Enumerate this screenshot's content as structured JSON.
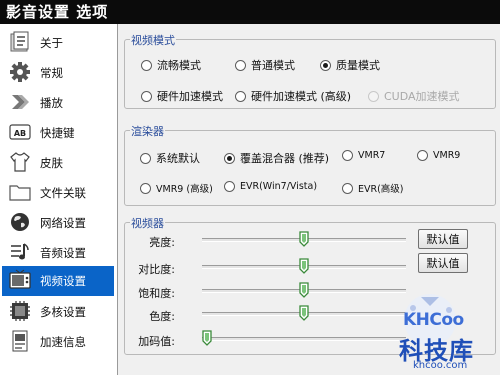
{
  "window": {
    "title": "影音设置 选项"
  },
  "sidebar": {
    "items": [
      {
        "label": "关于",
        "icon": "info-icon"
      },
      {
        "label": "常规",
        "icon": "gear-icon"
      },
      {
        "label": "播放",
        "icon": "play-icon"
      },
      {
        "label": "快捷键",
        "icon": "keyboard-ab-icon"
      },
      {
        "label": "皮肤",
        "icon": "shirt-icon"
      },
      {
        "label": "文件关联",
        "icon": "folder-icon"
      },
      {
        "label": "网络设置",
        "icon": "globe-icon"
      },
      {
        "label": "音频设置",
        "icon": "music-note-icon"
      },
      {
        "label": "视频设置",
        "icon": "tv-icon",
        "selected": true
      },
      {
        "label": "多核设置",
        "icon": "cpu-icon"
      },
      {
        "label": "加速信息",
        "icon": "document-icon"
      }
    ],
    "selected_color": "#0a64c8"
  },
  "video_mode": {
    "title": "视频模式",
    "options": [
      {
        "label": "流畅模式",
        "checked": false,
        "disabled": false
      },
      {
        "label": "普通模式",
        "checked": false,
        "disabled": false
      },
      {
        "label": "质量模式",
        "checked": true,
        "disabled": false
      },
      {
        "label": "硬件加速模式",
        "checked": false,
        "disabled": false
      },
      {
        "label": "硬件加速模式 (高级)",
        "checked": false,
        "disabled": false
      },
      {
        "label": "CUDA加速模式",
        "checked": false,
        "disabled": true
      }
    ]
  },
  "renderer": {
    "title": "渲染器",
    "options": [
      {
        "label": "系统默认",
        "checked": false
      },
      {
        "label": "覆盖混合器 (推荐)",
        "checked": true
      },
      {
        "label": "VMR7",
        "checked": false
      },
      {
        "label": "VMR9",
        "checked": false
      },
      {
        "label": "VMR9 (高级)",
        "checked": false
      },
      {
        "label": "EVR(Win7/Vista)",
        "checked": false
      },
      {
        "label": "EVR(高级)",
        "checked": false
      }
    ]
  },
  "video_adjust": {
    "title": "视频器",
    "sliders": [
      {
        "label": "亮度:",
        "value": 0.5
      },
      {
        "label": "对比度:",
        "value": 0.5
      },
      {
        "label": "饱和度:",
        "value": 0.5
      },
      {
        "label": "色度:",
        "value": 0.5
      },
      {
        "label": "加码值:",
        "value": 0.0
      }
    ],
    "default_buttons": [
      "默认值",
      "默认值"
    ]
  },
  "watermark": {
    "logo_text": "KHCoo",
    "name": "科技库",
    "url": "khcoo.com"
  }
}
